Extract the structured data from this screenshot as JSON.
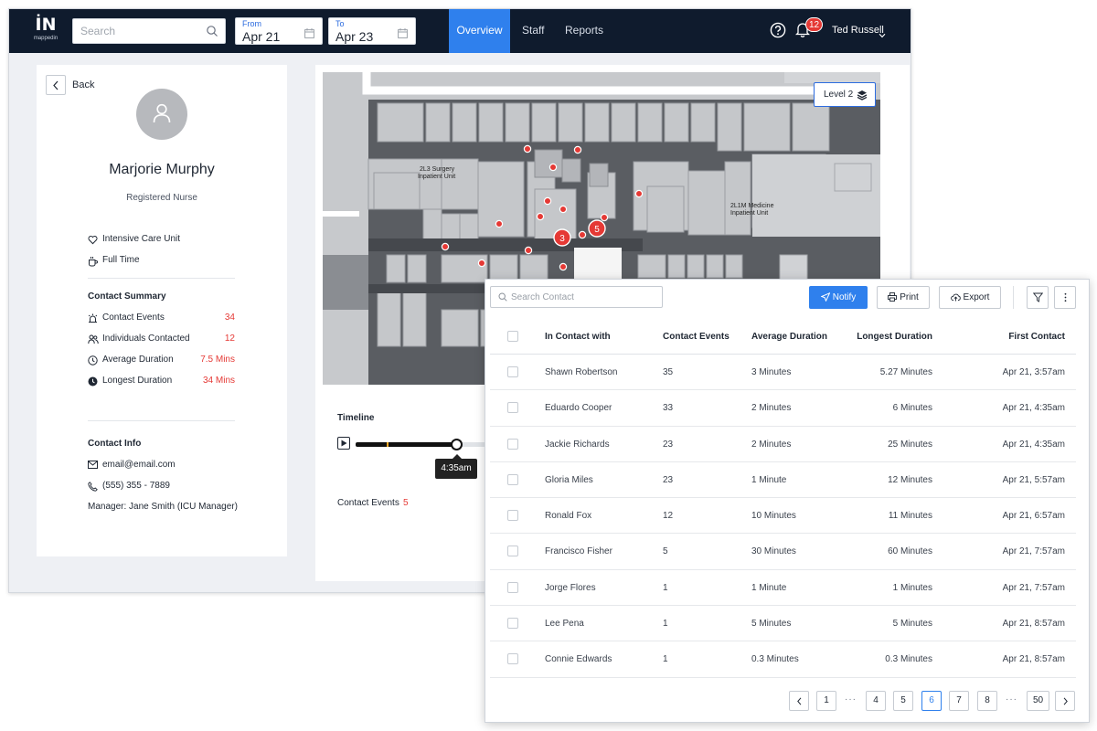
{
  "header": {
    "logo_mark": "İN",
    "logo_text": "mappedin",
    "search_placeholder": "Search",
    "from_label": "From",
    "from_value": "Apr 21",
    "to_label": "To",
    "to_value": "Apr 23",
    "nav": [
      {
        "label": "Overview",
        "active": true
      },
      {
        "label": "Staff",
        "active": false
      },
      {
        "label": "Reports",
        "active": false
      }
    ],
    "notification_count": "12",
    "user_name": "Ted Russell",
    "accent_color": "#2f80ed",
    "bar_color": "#0f1b2d"
  },
  "profile": {
    "back_label": "Back",
    "name": "Marjorie Murphy",
    "role": "Registered Nurse",
    "department": "Intensive Care Unit",
    "employment": "Full Time",
    "summary_title": "Contact Summary",
    "summary": [
      {
        "label": "Contact Events",
        "value": "34",
        "icon": "siren-icon"
      },
      {
        "label": "Individuals Contacted",
        "value": "12",
        "icon": "people-icon"
      },
      {
        "label": "Average Duration",
        "value": "7.5 Mins",
        "icon": "clock-icon"
      },
      {
        "label": "Longest Duration",
        "value": "34 Mins",
        "icon": "clock-filled-icon"
      }
    ],
    "contact_title": "Contact Info",
    "email": "email@email.com",
    "phone": "(555) 355 - 7889",
    "manager": "Manager: Jane Smith (ICU Manager)",
    "highlight_color": "#e53935"
  },
  "map": {
    "level_label": "Level 2",
    "labels": [
      "2L3 Surgery",
      "Inpatient Unit",
      "2L1M Medicine",
      "Inpatient Unit"
    ],
    "clusters": [
      "3",
      "5"
    ],
    "timeline_title": "Timeline",
    "timeline_progress": 0.29,
    "time_tooltip": "4:35am",
    "contact_events_label": "Contact Events",
    "contact_events_value": "5"
  },
  "contacts": {
    "search_placeholder": "Search Contact",
    "notify_label": "Notify",
    "print_label": "Print",
    "export_label": "Export",
    "columns": [
      "In Contact with",
      "Contact Events",
      "Average Duration",
      "Longest Duration",
      "First Contact"
    ],
    "rows": [
      [
        "Shawn Robertson",
        "35",
        "3 Minutes",
        "5.27 Minutes",
        "Apr 21, 3:57am"
      ],
      [
        "Eduardo Cooper",
        "33",
        "2 Minutes",
        "6 Minutes",
        "Apr 21, 4:35am"
      ],
      [
        "Jackie Richards",
        "23",
        "2 Minutes",
        "25 Minutes",
        "Apr 21, 4:35am"
      ],
      [
        "Gloria Miles",
        "23",
        "1 Minute",
        "12 Minutes",
        "Apr 21, 5:57am"
      ],
      [
        "Ronald Fox",
        "12",
        "10 Minutes",
        "11 Minutes",
        "Apr 21, 6:57am"
      ],
      [
        "Francisco Fisher",
        "5",
        "30 Minutes",
        "60 Minutes",
        "Apr 21, 7:57am"
      ],
      [
        "Jorge Flores",
        "1",
        "1 Minute",
        "1 Minutes",
        "Apr 21, 7:57am"
      ],
      [
        "Lee Pena",
        "1",
        "5 Minutes",
        "5 Minutes",
        "Apr 21, 8:57am"
      ],
      [
        "Connie Edwards",
        "1",
        "0.3 Minutes",
        "0.3 Minutes",
        "Apr 21, 8:57am"
      ]
    ],
    "pagination": {
      "pages": [
        "1",
        "4",
        "5",
        "6",
        "7",
        "8",
        "50"
      ],
      "current": "6",
      "ellipsis": "···"
    }
  }
}
